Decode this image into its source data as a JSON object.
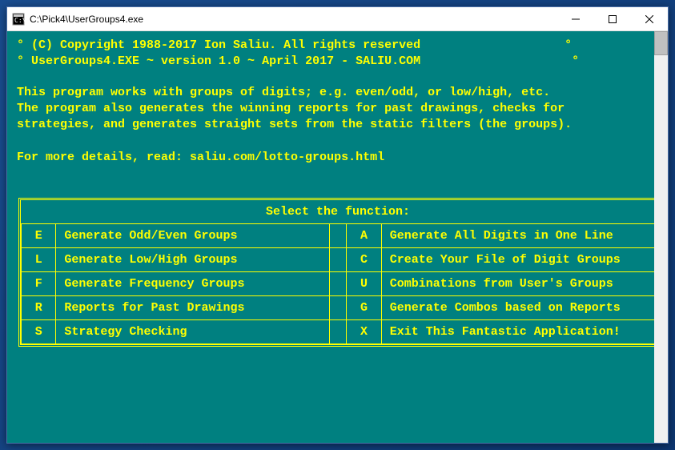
{
  "window": {
    "title": "C:\\Pick4\\UserGroups4.exe"
  },
  "header": {
    "line1": "(C) Copyright 1988-2017 Ion Saliu. All rights reserved",
    "line2": "UserGroups4.EXE ~ version 1.0 ~ April 2017 - SALIU.COM"
  },
  "description": {
    "p1": "This program works with groups of digits; e.g. even/odd, or low/high, etc.",
    "p2": "The program also generates the winning reports for past drawings, checks for",
    "p3": "strategies, and generates straight sets from the static filters (the groups).",
    "p4": "For more details, read: saliu.com/lotto-groups.html"
  },
  "menu": {
    "title": "Select the function:",
    "left": [
      {
        "key": "E",
        "label": "Generate Odd/Even Groups"
      },
      {
        "key": "L",
        "label": "Generate Low/High Groups"
      },
      {
        "key": "F",
        "label": "Generate Frequency Groups"
      },
      {
        "key": "R",
        "label": "Reports for Past Drawings"
      },
      {
        "key": "S",
        "label": "Strategy Checking"
      }
    ],
    "right": [
      {
        "key": "A",
        "label": "Generate All Digits in One Line"
      },
      {
        "key": "C",
        "label": "Create Your File of Digit Groups"
      },
      {
        "key": "U",
        "label": "Combinations from User's Groups"
      },
      {
        "key": "G",
        "label": "Generate Combos based on Reports"
      },
      {
        "key": "X",
        "label": "Exit This Fantastic Application!"
      }
    ]
  }
}
